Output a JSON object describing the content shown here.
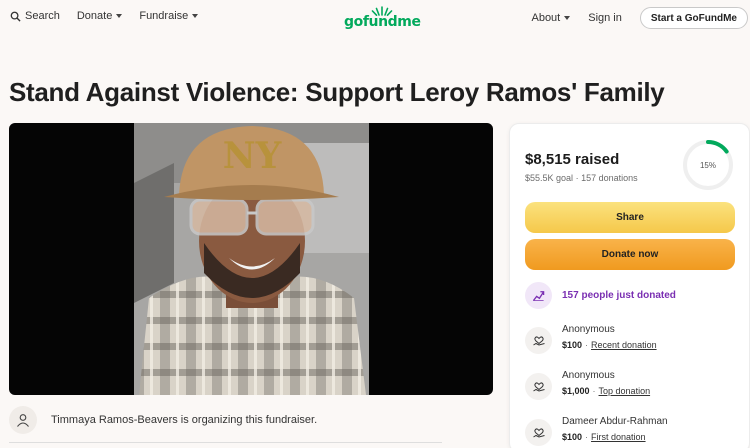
{
  "header": {
    "nav_left": [
      {
        "label": "Search",
        "icon": "search-icon"
      },
      {
        "label": "Donate",
        "icon": "chevron-down-icon"
      },
      {
        "label": "Fundraise",
        "icon": "chevron-down-icon"
      }
    ],
    "logo_text": "gofundme",
    "nav_right": [
      {
        "label": "About",
        "icon": "chevron-down-icon"
      },
      {
        "label": "Sign in"
      }
    ],
    "start_button": "Start a GoFundMe"
  },
  "page_title": "Stand Against Violence: Support Leroy Ramos' Family",
  "organizer": {
    "text": "Timmaya Ramos-Beavers is organizing this fundraiser."
  },
  "card": {
    "raised": "$8,515 raised",
    "goal": "$55.5K goal",
    "donations": "157 donations",
    "progress_label": "15%",
    "progress_fraction": 0.15,
    "share_label": "Share",
    "donate_label": "Donate now",
    "trend_text": "157 people just donated",
    "donations_list": [
      {
        "name": "Anonymous",
        "amount": "$100",
        "tag": "Recent donation"
      },
      {
        "name": "Anonymous",
        "amount": "$1,000",
        "tag": "Top donation"
      },
      {
        "name": "Dameer Abdur-Rahman",
        "amount": "$100",
        "tag": "First donation"
      }
    ]
  },
  "colors": {
    "brand_green": "#02a95c",
    "share_yellow": "#f5c84a",
    "donate_orange": "#f09a1f",
    "trend_purple": "#7a2fb2"
  }
}
